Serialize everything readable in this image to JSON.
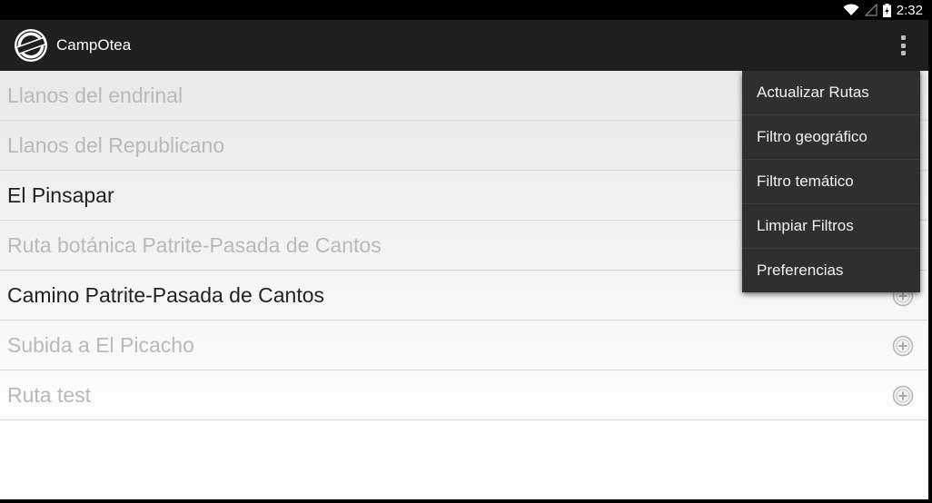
{
  "status_bar": {
    "time": "2:32",
    "icons": [
      "wifi-icon",
      "cell-signal-icon",
      "battery-charging-icon"
    ]
  },
  "action_bar": {
    "title": "CampOtea",
    "logo": "campotea-logo",
    "overflow_icon": "more-vertical-icon"
  },
  "routes": [
    {
      "name": "Llanos del endrinal",
      "state": "inactive"
    },
    {
      "name": "Llanos del Republicano",
      "state": "inactive"
    },
    {
      "name": "El Pinsapar",
      "state": "active"
    },
    {
      "name": "Ruta botánica Patrite-Pasada de Cantos",
      "state": "inactive"
    },
    {
      "name": "Camino Patrite-Pasada de Cantos",
      "state": "active"
    },
    {
      "name": "Subida a El Picacho",
      "state": "inactive"
    },
    {
      "name": "Ruta test",
      "state": "inactive"
    }
  ],
  "overflow_menu": {
    "items": [
      {
        "label": "Actualizar Rutas"
      },
      {
        "label": "Filtro geográfico"
      },
      {
        "label": "Filtro temático"
      },
      {
        "label": "Limpiar Filtros"
      },
      {
        "label": "Preferencias"
      }
    ]
  },
  "colors": {
    "action_bar": "#1f1f1f",
    "menu": "#2f2f2f",
    "inactive_text": "#b9b9b9",
    "active_text": "#222222"
  }
}
